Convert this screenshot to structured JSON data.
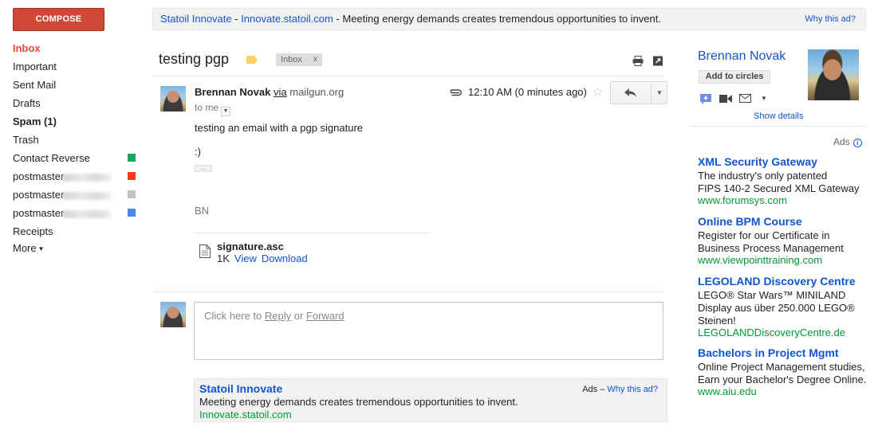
{
  "sidebar": {
    "compose_label": "COMPOSE",
    "items": [
      {
        "label": "Inbox"
      },
      {
        "label": "Important"
      },
      {
        "label": "Sent Mail"
      },
      {
        "label": "Drafts"
      },
      {
        "label": "Spam (1)"
      },
      {
        "label": "Trash"
      },
      {
        "label": "Contact Reverse",
        "color": "#16a765"
      },
      {
        "label": "postmaster",
        "color": "#f83a22"
      },
      {
        "label": "postmaster",
        "color": "#c2c2c2"
      },
      {
        "label": "postmaster",
        "color": "#4986e7"
      },
      {
        "label": "Receipts"
      },
      {
        "label": "More"
      }
    ]
  },
  "top_ad": {
    "title": "Statoil Innovate",
    "separator1": " - ",
    "url": "Innovate.statoil.com",
    "text": " - Meeting energy demands creates tremendous opportunities to invent.",
    "why": "Why this ad?"
  },
  "conversation": {
    "subject": "testing pgp",
    "label_chip": "Inbox",
    "label_chip_close": "x",
    "label_color": "#fad165"
  },
  "message": {
    "sender_name": "Brennan Novak",
    "via_label": "via",
    "via_domain": "mailgun.org",
    "to": "to me",
    "time": "12:10 AM (0 minutes ago)",
    "body": [
      "testing an email with a pgp signature",
      ":)"
    ],
    "signature": "BN",
    "attachment": {
      "name": "signature.asc",
      "size": "1K",
      "view_label": "View",
      "download_label": "Download"
    }
  },
  "reply_box": {
    "prefix": "Click here to ",
    "reply": "Reply",
    "or": " or ",
    "forward": "Forward"
  },
  "bottom_ad": {
    "title": "Statoil Innovate",
    "text": "Meeting energy demands creates tremendous opportunities to invent.",
    "url": "Innovate.statoil.com",
    "ads_label": "Ads",
    "dash": " – ",
    "why": "Why this ad?"
  },
  "contact": {
    "name": "Brennan Novak",
    "add_to_circles": "Add to circles",
    "show_details": "Show details"
  },
  "right_ads": {
    "label": "Ads",
    "items": [
      {
        "title": "XML Security Gateway",
        "lines": [
          "The industry's only patented",
          "FIPS 140-2 Secured XML Gateway"
        ],
        "url": "www.forumsys.com"
      },
      {
        "title": "Online BPM Course",
        "lines": [
          "Register for our Certificate in",
          "Business Process Management"
        ],
        "url": "www.viewpointtraining.com"
      },
      {
        "title": "LEGOLAND Discovery Centre",
        "lines": [
          "LEGO® Star Wars™ MINILAND",
          "Display aus über 250.000 LEGO®",
          "Steinen!"
        ],
        "url": "LEGOLANDDiscoveryCentre.de"
      },
      {
        "title": "Bachelors in Project Mgmt",
        "lines": [
          "Online Project Management studies,",
          "Earn your Bachelor's Degree Online."
        ],
        "url": "www.aiu.edu"
      }
    ]
  },
  "icons": [
    "print-icon",
    "new-window-icon",
    "paperclip-icon",
    "star-icon",
    "reply-icon",
    "chevron-down-icon",
    "document-icon",
    "chat-icon",
    "video-icon",
    "mail-icon",
    "info-icon"
  ]
}
